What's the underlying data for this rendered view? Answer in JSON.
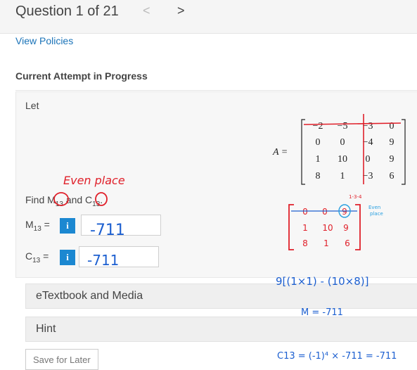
{
  "header": {
    "question_label": "Question 1 of 21",
    "prev_arrow": "<",
    "next_arrow": ">"
  },
  "links": {
    "view_policies": "View Policies"
  },
  "attempt_status": "Current Attempt in Progress",
  "problem": {
    "intro": "Let",
    "matrix_name": "A =",
    "matrix": [
      [
        "−2",
        "−5",
        "−3",
        "0"
      ],
      [
        "0",
        "0",
        "−4",
        "9"
      ],
      [
        "1",
        "10",
        "0",
        "9"
      ],
      [
        "8",
        "1",
        "−3",
        "6"
      ]
    ],
    "find_prefix": "Find M",
    "find_m_sub": "13",
    "find_and": " and C",
    "find_c_sub": "13",
    "find_suffix": "."
  },
  "fields": {
    "m13": {
      "label": "M",
      "sub": "13",
      "eq": " =",
      "info": "i",
      "value": "-711"
    },
    "c13": {
      "label": "C",
      "sub": "13",
      "eq": " =",
      "info": "i",
      "value": "-711"
    }
  },
  "sections": {
    "etextbook": "eTextbook and Media",
    "hint": "Hint"
  },
  "buttons": {
    "save_for_later": "Save for Later"
  },
  "annotations": {
    "even_place": "Even place",
    "minor_label": "1-3-4",
    "small_even": "Even",
    "small_place": "place",
    "minor_matrix": [
      [
        "0",
        "0",
        "9"
      ],
      [
        "1",
        "10",
        "9"
      ],
      [
        "8",
        "1",
        "6"
      ]
    ],
    "work_line1": "9[(1×1) - (10×8)]",
    "work_line2": "M = -711",
    "work_line3": "C13 = (-1)⁴ × -711 = -711"
  },
  "colors": {
    "link": "#1a73b8",
    "info_button": "#1c88d1",
    "ink_blue": "#1c5fd0",
    "ink_red": "#e0202a",
    "ink_cyan": "#2aa0e0"
  }
}
